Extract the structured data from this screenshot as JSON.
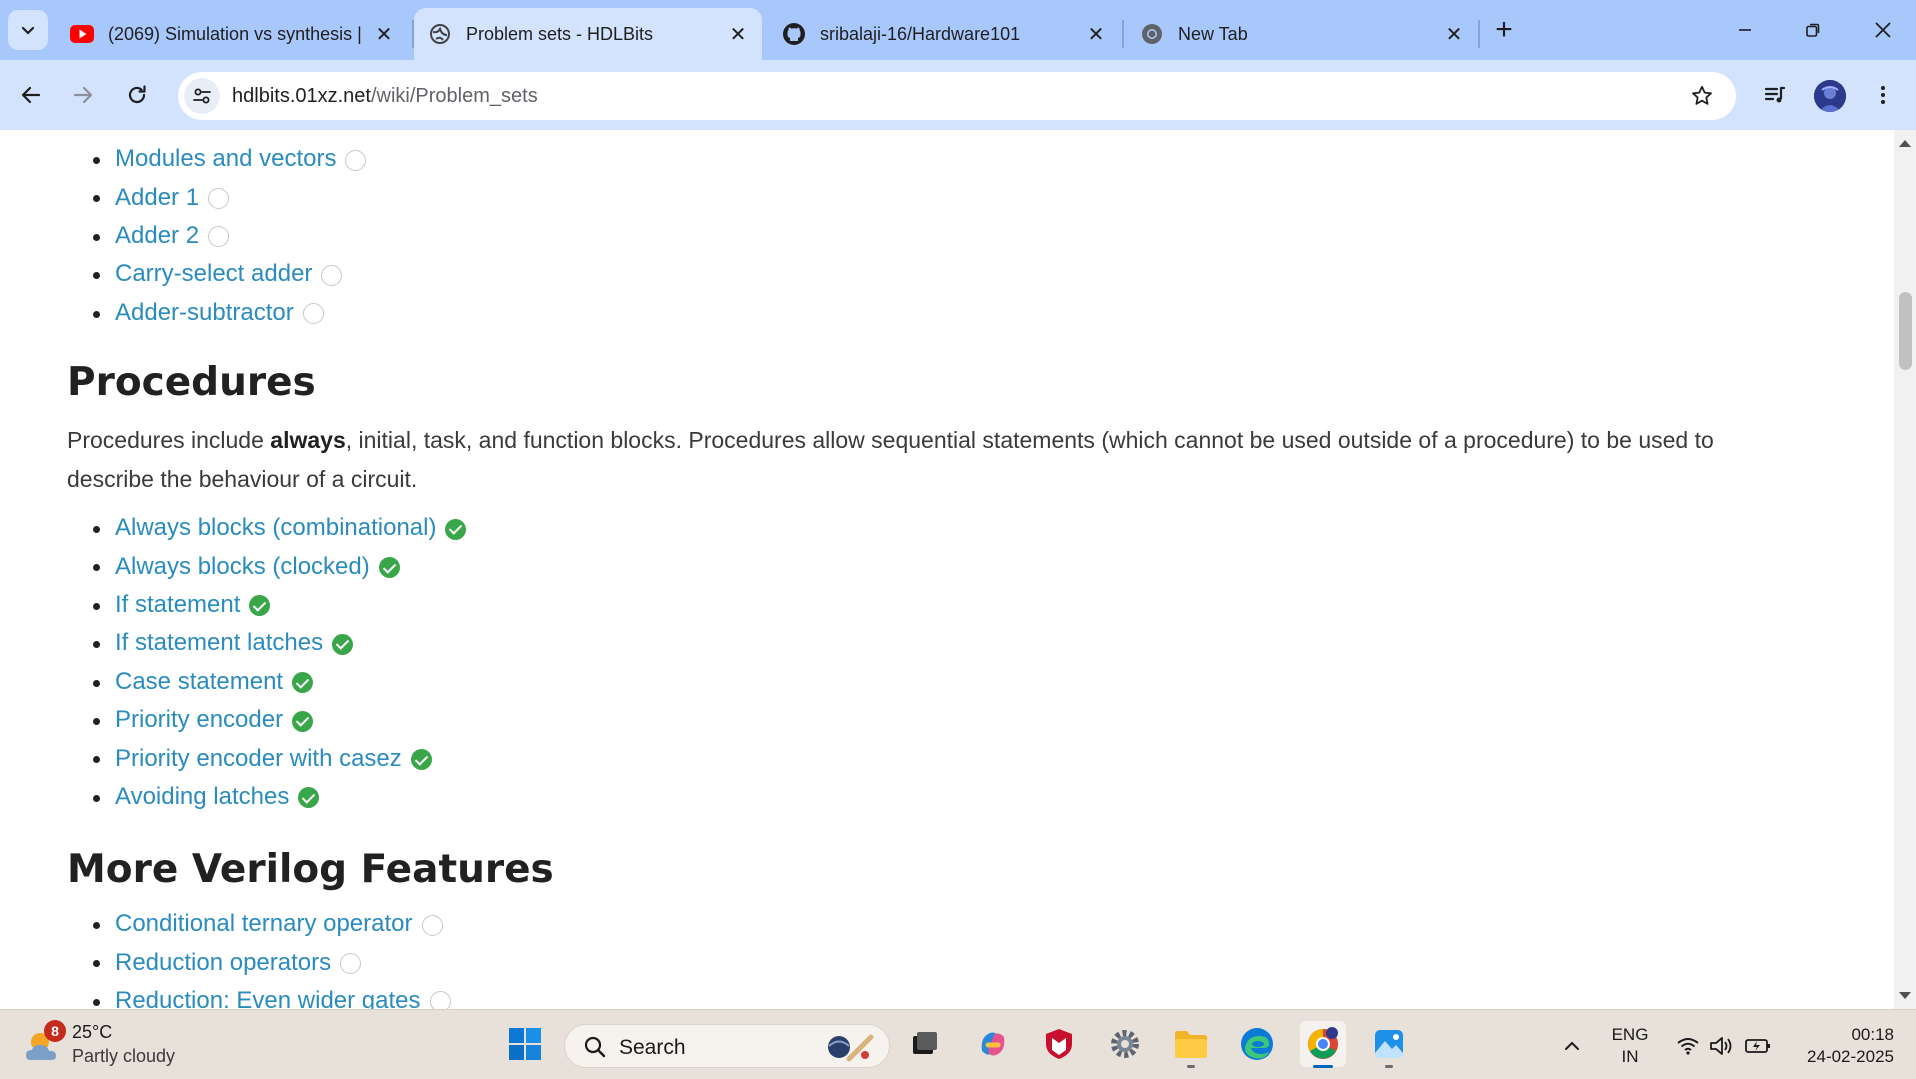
{
  "browser": {
    "tabs": [
      {
        "title": "(2069) Simulation vs synthesis |",
        "favicon": "youtube-icon",
        "active": false
      },
      {
        "title": "Problem sets - HDLBits",
        "favicon": "globe-icon",
        "active": true
      },
      {
        "title": "sribalaji-16/Hardware101",
        "favicon": "github-icon",
        "active": false
      },
      {
        "title": "New Tab",
        "favicon": "chrome-icon",
        "active": false
      }
    ],
    "url_host": "hdlbits.01xz.net",
    "url_path": "/wiki/Problem_sets"
  },
  "page": {
    "top_list": [
      {
        "label": "Modules and vectors",
        "solved": false
      },
      {
        "label": "Adder 1",
        "solved": false
      },
      {
        "label": "Adder 2",
        "solved": false
      },
      {
        "label": "Carry-select adder",
        "solved": false
      },
      {
        "label": "Adder-subtractor",
        "solved": false
      }
    ],
    "procedures": {
      "heading": "Procedures",
      "desc_before": "Procedures include ",
      "desc_bold": "always",
      "desc_after": ", initial, task, and function blocks. Procedures allow sequential statements (which cannot be used outside of a procedure) to be used to describe the behaviour of a circuit.",
      "items": [
        {
          "label": "Always blocks (combinational)",
          "solved": true
        },
        {
          "label": "Always blocks (clocked)",
          "solved": true
        },
        {
          "label": "If statement",
          "solved": true
        },
        {
          "label": "If statement latches",
          "solved": true
        },
        {
          "label": "Case statement",
          "solved": true
        },
        {
          "label": "Priority encoder",
          "solved": true
        },
        {
          "label": "Priority encoder with casez",
          "solved": true
        },
        {
          "label": "Avoiding latches",
          "solved": true
        }
      ]
    },
    "more_features": {
      "heading": "More Verilog Features",
      "items": [
        {
          "label": "Conditional ternary operator",
          "solved": false
        },
        {
          "label": "Reduction operators",
          "solved": false
        },
        {
          "label": "Reduction: Even wider gates",
          "solved": false
        }
      ]
    }
  },
  "taskbar": {
    "weather_badge": "8",
    "weather_temp": "25°C",
    "weather_desc": "Partly cloudy",
    "search_label": "Search",
    "lang_top": "ENG",
    "lang_bottom": "IN",
    "time": "00:18",
    "date": "24-02-2025"
  },
  "colors": {
    "link": "#2a8bbf",
    "solved_check": "#3aa64a",
    "tabstrip": "#a8c7fa",
    "toolbar": "#d3e3fd",
    "taskbar": "#e7e1da"
  }
}
